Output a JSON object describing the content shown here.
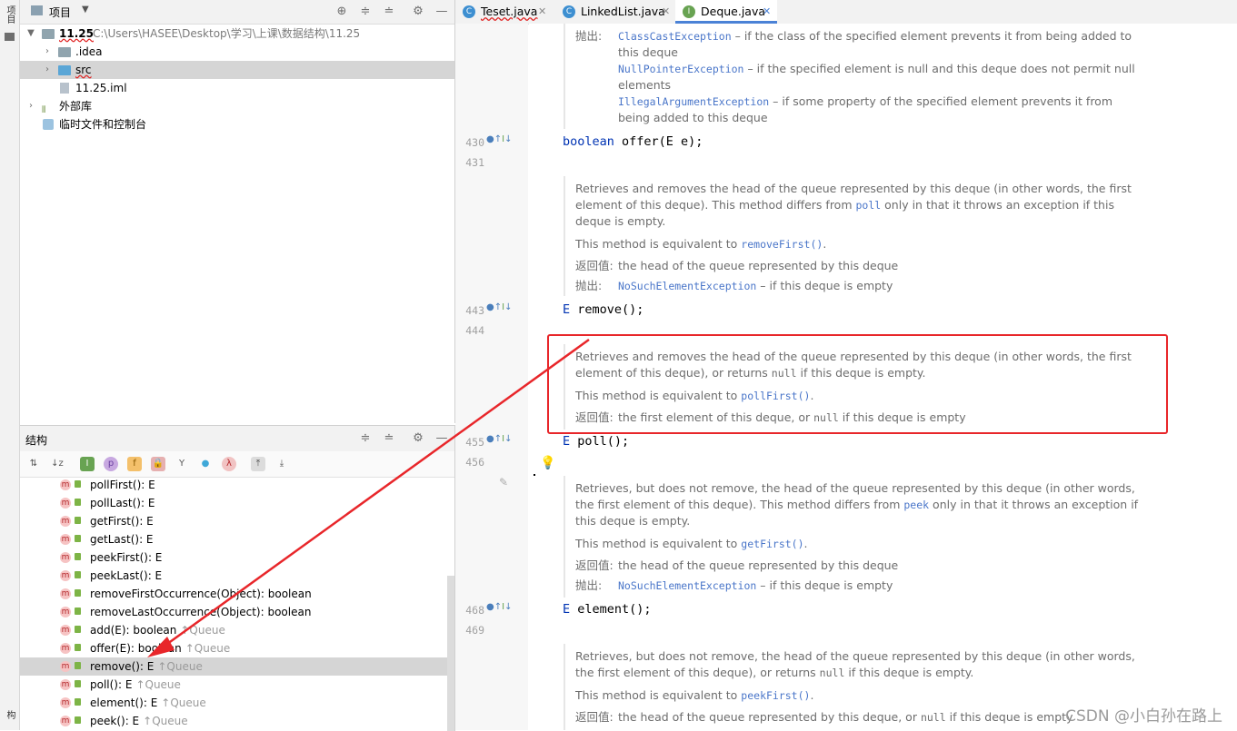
{
  "sidebar": {
    "project_tab": "项目",
    "structure_tab": "构"
  },
  "project_panel": {
    "title": "项目",
    "tree": [
      {
        "name": "11.25",
        "path": "C:\\Users\\HASEE\\Desktop\\学习\\上课\\数据结构\\11.25"
      },
      {
        "name": ".idea"
      },
      {
        "name": "src"
      },
      {
        "name": "11.25.iml"
      },
      {
        "name": "外部库"
      },
      {
        "name": "临时文件和控制台"
      }
    ]
  },
  "structure_panel": {
    "title": "结构",
    "members": [
      {
        "name": "pollFirst(): E",
        "inherited": ""
      },
      {
        "name": "pollLast(): E",
        "inherited": ""
      },
      {
        "name": "getFirst(): E",
        "inherited": ""
      },
      {
        "name": "getLast(): E",
        "inherited": ""
      },
      {
        "name": "peekFirst(): E",
        "inherited": ""
      },
      {
        "name": "peekLast(): E",
        "inherited": ""
      },
      {
        "name": "removeFirstOccurrence(Object): boolean",
        "inherited": ""
      },
      {
        "name": "removeLastOccurrence(Object): boolean",
        "inherited": ""
      },
      {
        "name": "add(E): boolean",
        "inherited": "↑Queue"
      },
      {
        "name": "offer(E): boolean",
        "inherited": "↑Queue"
      },
      {
        "name": "remove(): E",
        "inherited": "↑Queue"
      },
      {
        "name": "poll(): E",
        "inherited": "↑Queue"
      },
      {
        "name": "element(): E",
        "inherited": "↑Queue"
      },
      {
        "name": "peek(): E",
        "inherited": "↑Queue"
      }
    ]
  },
  "tabs": [
    {
      "label": "Teset.java",
      "icon": "C"
    },
    {
      "label": "LinkedList.java",
      "icon": "C"
    },
    {
      "label": "Deque.java",
      "icon": "I"
    }
  ],
  "editor": {
    "line_numbers": [
      "430",
      "431",
      "443",
      "444",
      "455",
      "456",
      "468",
      "469"
    ],
    "block0": {
      "throws_label": "抛出:",
      "t1_ex": "ClassCastException",
      "t1_desc": " – if the class of the specified element prevents it from being added to this deque",
      "t2_ex": "NullPointerException",
      "t2_desc": " – if the specified element is null and this deque does not permit null elements",
      "t3_ex": "IllegalArgumentException",
      "t3_desc": " – if some property of the specified element prevents it from being added to this deque"
    },
    "code_offer": {
      "kw": "boolean",
      "rest": " offer(E e);"
    },
    "block_remove": {
      "p1a": "Retrieves and removes the head of the queue represented by this deque (in other words, the first element of this deque). This method differs from ",
      "p1code": "poll",
      "p1b": " only in that it throws an exception if this deque is empty.",
      "p2a": "This method is equivalent to ",
      "p2code": "removeFirst()",
      "p2b": ".",
      "ret_label": "返回值:",
      "ret": "the head of the queue represented by this deque",
      "throws_label": "抛出:",
      "ex": "NoSuchElementException",
      "ex_desc": " – if this deque is empty"
    },
    "code_remove": {
      "kw": "E",
      "rest": " remove();"
    },
    "block_poll": {
      "p1a": "Retrieves and removes the head of the queue represented by this deque (in other words, the first element of this deque), or returns ",
      "p1code": "null",
      "p1b": " if this deque is empty.",
      "p2a": "This method is equivalent to ",
      "p2code": "pollFirst()",
      "p2b": ".",
      "ret_label": "返回值:",
      "ret_a": "the first element of this deque, or ",
      "ret_code": "null",
      "ret_b": " if this deque is empty"
    },
    "code_poll": {
      "kw": "E",
      "rest": " poll();"
    },
    "block_element": {
      "p1a": "Retrieves, but does not remove, the head of the queue represented by this deque (in other words, the first element of this deque). This method differs from ",
      "p1code": "peek",
      "p1b": " only in that it throws an exception if this deque is empty.",
      "p2a": "This method is equivalent to ",
      "p2code": "getFirst()",
      "p2b": ".",
      "ret_label": "返回值:",
      "ret": "the head of the queue represented by this deque",
      "throws_label": "抛出:",
      "ex": "NoSuchElementException",
      "ex_desc": " – if this deque is empty"
    },
    "code_element": {
      "kw": "E",
      "rest": " element();"
    },
    "block_peek": {
      "p1a": "Retrieves, but does not remove, the head of the queue represented by this deque (in other words, the first element of this deque), or returns ",
      "p1code": "null",
      "p1b": " if this deque is empty.",
      "p2a": "This method is equivalent to ",
      "p2code": "peekFirst()",
      "p2b": ".",
      "ret_label": "返回值:",
      "ret_a": "the head of the queue represented by this deque, or ",
      "ret_code": "null",
      "ret_b": " if this deque is empty"
    }
  },
  "watermark": "CSDN @小白孙在路上",
  "colors": {
    "annotation_red": "#e8262a",
    "link_blue": "#4a76c9",
    "keyword_blue": "#0033b3"
  }
}
